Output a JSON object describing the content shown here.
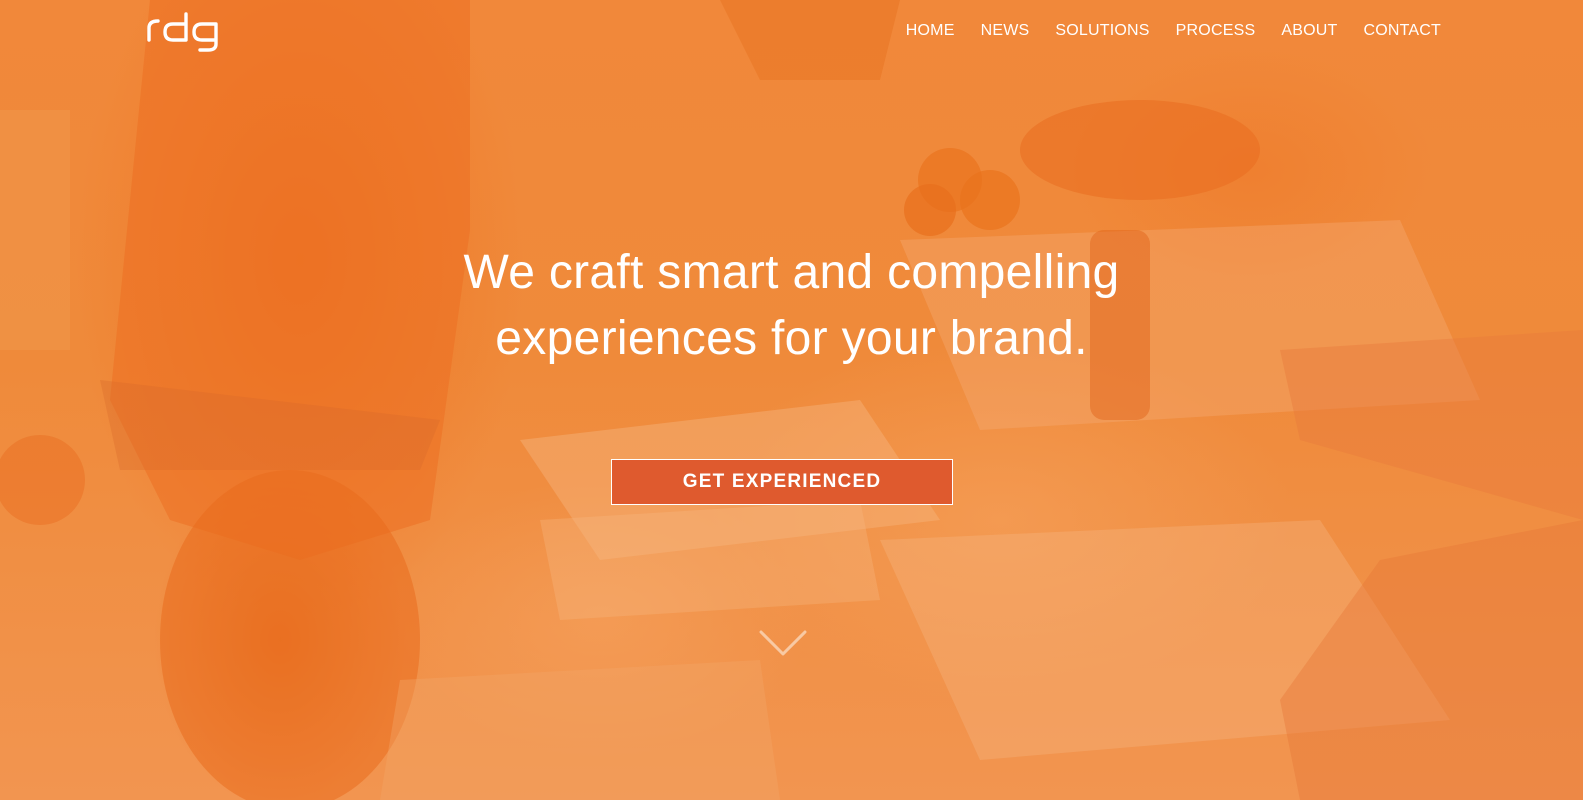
{
  "brand": {
    "logo_text": "rdg",
    "logo_color": "#ffffff"
  },
  "nav": {
    "items": [
      {
        "label": "HOME"
      },
      {
        "label": "NEWS"
      },
      {
        "label": "SOLUTIONS"
      },
      {
        "label": "PROCESS"
      },
      {
        "label": "ABOUT"
      },
      {
        "label": "CONTACT"
      }
    ]
  },
  "hero": {
    "headline_line1": "We craft smart and compelling",
    "headline_line2": "experiences for your brand.",
    "cta_label": "GET EXPERIENCED",
    "scroll_icon": "chevron-down-icon",
    "overlay_color": "#ef8a34",
    "cta_color": "#df5a2e"
  }
}
